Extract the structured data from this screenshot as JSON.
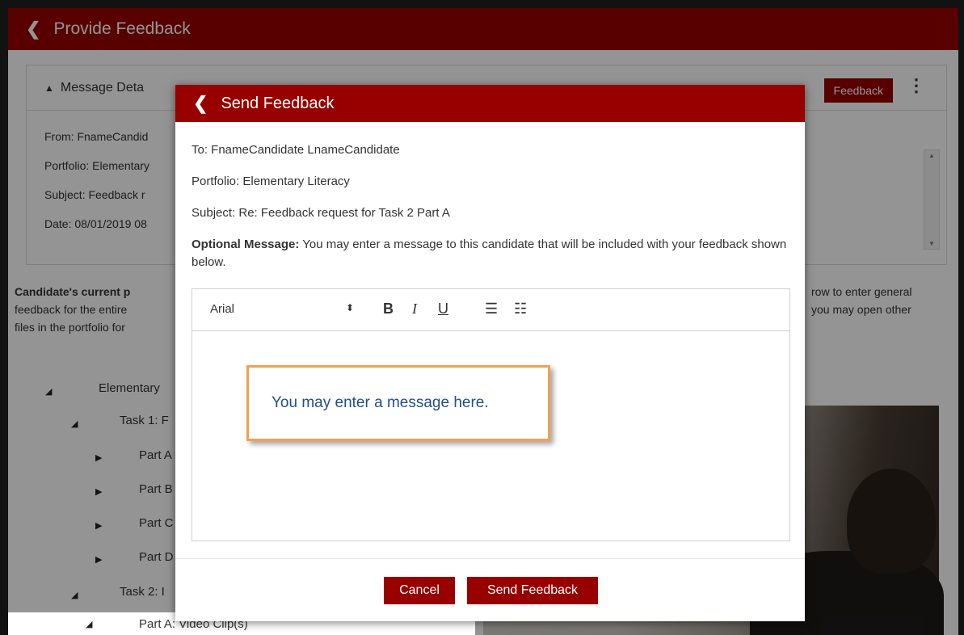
{
  "page": {
    "title": "Provide Feedback",
    "details_title": "Message Deta",
    "top_button": "Feedback",
    "meta": {
      "from": "From: FnameCandid",
      "portfolio": "Portfolio: Elementary",
      "subject": "Subject: Feedback r",
      "date": "Date: 08/01/2019 08"
    },
    "instructions_left": [
      "Candidate's current p",
      "feedback for the entire",
      "files in the portfolio for"
    ],
    "instructions_right": [
      "row to enter general",
      "you may open other"
    ],
    "tree": [
      "Elementary",
      "Task 1: F",
      "Part A",
      "Part B",
      "Part C",
      "Part D",
      "Task 2: I",
      "Part A: Video Clip(s)"
    ]
  },
  "modal": {
    "title": "Send Feedback",
    "to": "To: FnameCandidate LnameCandidate",
    "portfolio": "Portfolio: Elementary Literacy",
    "subject": "Subject: Re: Feedback request for Task 2 Part A",
    "optional_label": "Optional Message:",
    "optional_text": "You may enter a message to this candidate that will be included with your feedback shown below.",
    "editor": {
      "font": "Arial",
      "bold": "B",
      "italic": "I",
      "underline": "U"
    },
    "callout": "You may enter a message here.",
    "cancel": "Cancel",
    "send": "Send Feedback"
  },
  "icons": {
    "back": "chevron-left-icon",
    "collapse": "caret-up-icon",
    "more": "kebab-icon",
    "ordered_list": "ordered-list-icon",
    "bullet_list": "bullet-list-icon"
  },
  "colors": {
    "brand": "#980000",
    "callout_border": "#f5a04a",
    "callout_text": "#1f4f8a"
  }
}
